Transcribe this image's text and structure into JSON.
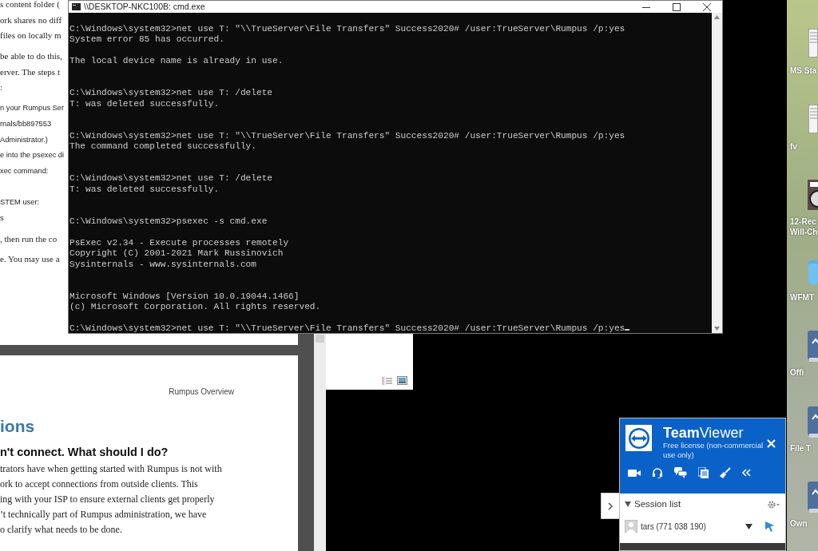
{
  "background_document": {
    "lines": [
      {
        "kind": "body",
        "text": "s content folder ("
      },
      {
        "kind": "body",
        "text": "ork shares no diff"
      },
      {
        "kind": "body",
        "text": "files on locally m"
      },
      {
        "kind": "gap"
      },
      {
        "kind": "body",
        "text": "be able to do this,"
      },
      {
        "kind": "body",
        "text": "erver. The steps t"
      },
      {
        "kind": "body",
        "text": ":"
      },
      {
        "kind": "gap"
      },
      {
        "kind": "step",
        "text": "n your Rumpus Ser"
      },
      {
        "kind": "step",
        "text": "rnals/bb897553"
      },
      {
        "kind": "step",
        "text": "Administrator.)"
      },
      {
        "kind": "step",
        "text": "e into the psexec di"
      },
      {
        "kind": "step",
        "text": "xec command:"
      },
      {
        "kind": "blank"
      },
      {
        "kind": "step",
        "text": "STEM user:"
      },
      {
        "kind": "step",
        "text": "s"
      },
      {
        "kind": "gap"
      },
      {
        "kind": "body",
        "text": ", then run the co"
      },
      {
        "kind": "gap"
      },
      {
        "kind": "body",
        "text": "e. You may use a"
      }
    ]
  },
  "cmd_window": {
    "title": "\\\\DESKTOP-NKC100B: cmd.exe",
    "lines": [
      {
        "kind": "output",
        "text": "C:\\Windows\\system32>net use T: \"\\\\TrueServer\\File Transfers\" Success2020# /user:TrueServer\\Rumpus /p:yes"
      },
      {
        "kind": "output",
        "text": "System error 85 has occurred."
      },
      {
        "kind": "blank"
      },
      {
        "kind": "output",
        "text": "The local device name is already in use."
      },
      {
        "kind": "blank"
      },
      {
        "kind": "blank"
      },
      {
        "kind": "output",
        "text": "C:\\Windows\\system32>net use T: /delete"
      },
      {
        "kind": "output",
        "text": "T: was deleted successfully."
      },
      {
        "kind": "blank"
      },
      {
        "kind": "blank"
      },
      {
        "kind": "output",
        "text": "C:\\Windows\\system32>net use T: \"\\\\TrueServer\\File Transfers\" Success2020# /user:TrueServer\\Rumpus /p:yes"
      },
      {
        "kind": "output",
        "text": "The command completed successfully."
      },
      {
        "kind": "blank"
      },
      {
        "kind": "blank"
      },
      {
        "kind": "output",
        "text": "C:\\Windows\\system32>net use T: /delete"
      },
      {
        "kind": "output",
        "text": "T: was deleted successfully."
      },
      {
        "kind": "blank"
      },
      {
        "kind": "blank"
      },
      {
        "kind": "output",
        "text": "C:\\Windows\\system32>psexec -s cmd.exe"
      },
      {
        "kind": "blank"
      },
      {
        "kind": "output",
        "text": "PsExec v2.34 - Execute processes remotely"
      },
      {
        "kind": "output",
        "text": "Copyright (C) 2001-2021 Mark Russinovich"
      },
      {
        "kind": "output",
        "text": "Sysinternals - www.sysinternals.com"
      },
      {
        "kind": "blank"
      },
      {
        "kind": "blank"
      },
      {
        "kind": "output",
        "text": "Microsoft Windows [Version 10.0.19044.1466]"
      },
      {
        "kind": "output",
        "text": "(c) Microsoft Corporation. All rights reserved."
      },
      {
        "kind": "blank"
      },
      {
        "kind": "prompt",
        "text": "C:\\Windows\\system32>net use T: \"\\\\TrueServer\\File Transfers\" Success2020# /user:TrueServer\\Rumpus /p:yes"
      }
    ]
  },
  "document_page": {
    "header": "Rumpus Overview",
    "heading": "ions",
    "subheading": "n't connect.  What should I do?",
    "lines": [
      "trators have when getting started with Rumpus is not with",
      "ork to accept connections from outside clients.  This",
      "ing with your ISP to ensure external clients get properly",
      "’t technically part of Rumpus administration, we have",
      "o clarify what needs to be done."
    ]
  },
  "desktop_icons": [
    {
      "kind": "document",
      "lines": [
        "MS Sta"
      ]
    },
    {
      "kind": "document",
      "lines": [
        "fv"
      ]
    },
    {
      "kind": "album",
      "lines": [
        "12-Rec",
        "Will-Ch"
      ]
    },
    {
      "kind": "folder",
      "lines": [
        "WFMT"
      ]
    },
    {
      "kind": "drive",
      "lines": [
        "Offi"
      ]
    },
    {
      "kind": "drive",
      "lines": [
        "File T"
      ]
    },
    {
      "kind": "drive",
      "lines": [
        "Own"
      ]
    }
  ],
  "teamviewer": {
    "title": "**Team**Viewer",
    "license": "Free license (non-commercial use only)",
    "session_list": {
      "title": "Session list",
      "expanded": true
    },
    "sessions": [
      {
        "name": "tars (771 038 190)"
      }
    ]
  }
}
